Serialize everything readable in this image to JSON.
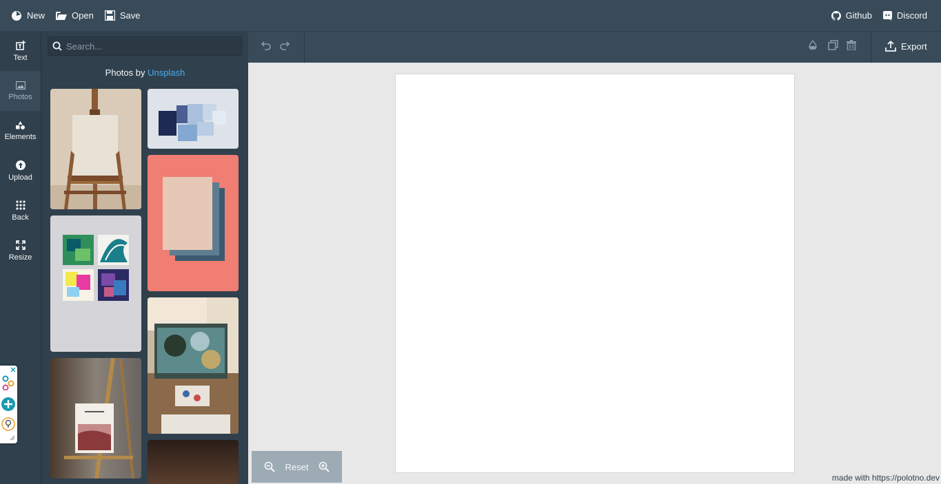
{
  "navbar": {
    "new_label": "New",
    "open_label": "Open",
    "save_label": "Save",
    "github_label": "Github",
    "discord_label": "Discord"
  },
  "sidetabs": [
    {
      "label": "Text",
      "icon": "text-add-icon"
    },
    {
      "label": "Photos",
      "icon": "photo-icon",
      "active": true
    },
    {
      "label": "Elements",
      "icon": "shapes-icon"
    },
    {
      "label": "Upload",
      "icon": "upload-icon"
    },
    {
      "label": "Back",
      "icon": "grid-dots-icon"
    },
    {
      "label": "Resize",
      "icon": "fullscreen-icon"
    }
  ],
  "panel": {
    "search_placeholder": "Search...",
    "credit_prefix": "Photos by ",
    "credit_link": "Unsplash"
  },
  "toolbar": {
    "export_label": "Export"
  },
  "workspace": {
    "zoom_reset_label": "Reset",
    "footer_credit": "made with https://polotno.dev"
  },
  "colors": {
    "navbar": "#394b59",
    "sidebar": "#30404d",
    "link": "#48aff0",
    "workspace": "#e8e8e8"
  }
}
